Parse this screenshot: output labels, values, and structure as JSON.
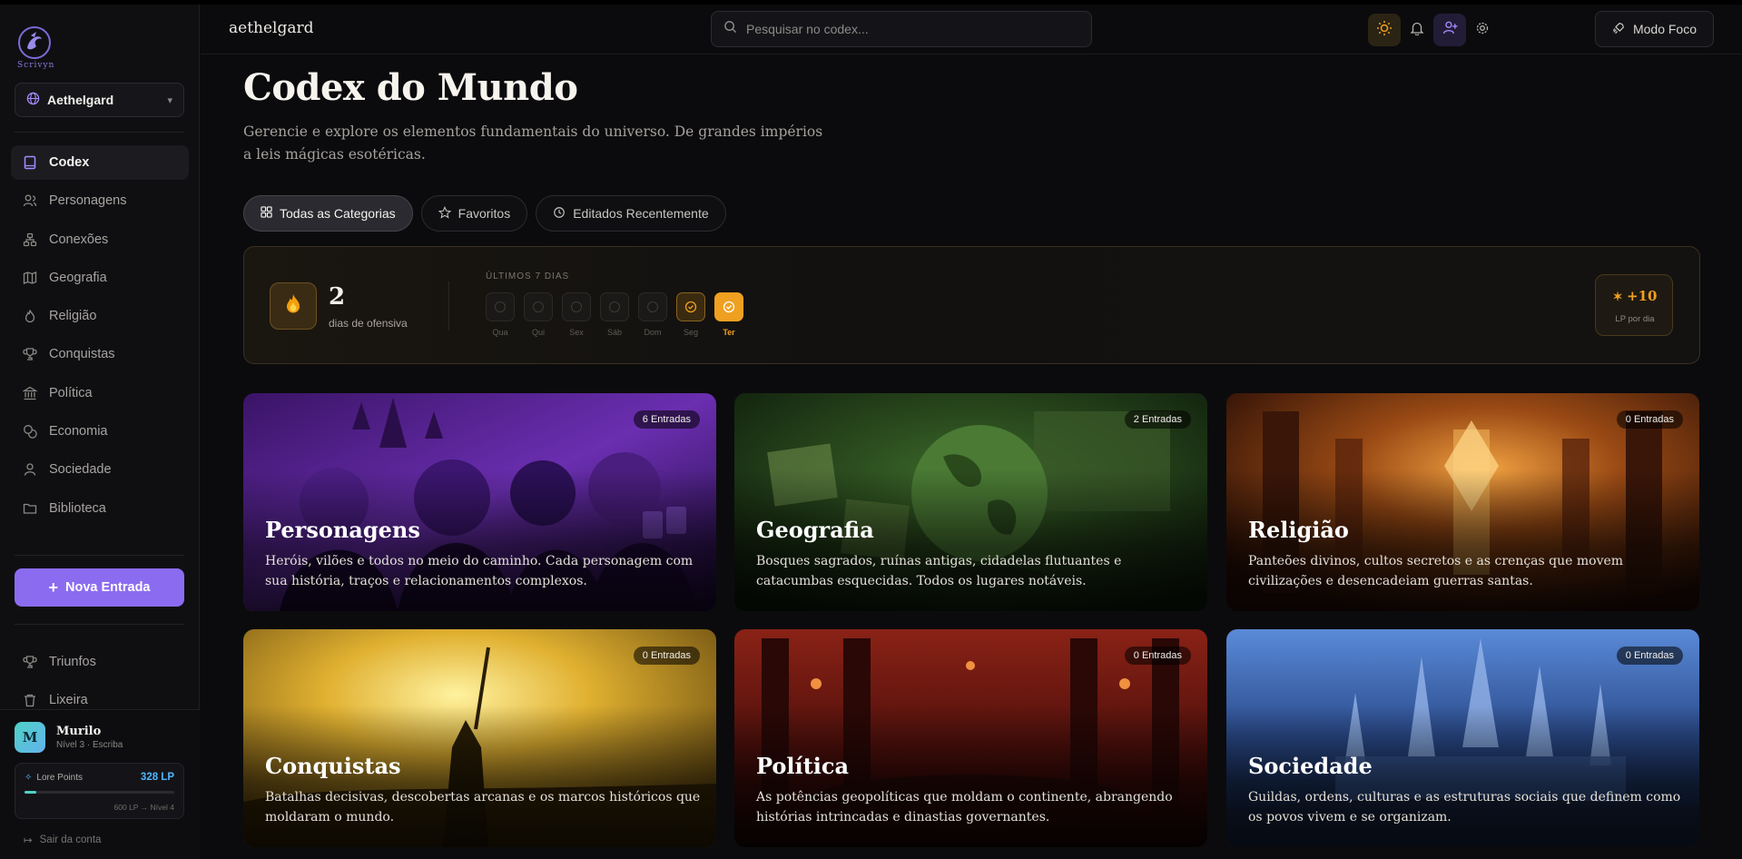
{
  "app": {
    "logo_text": "Scrivyn",
    "world": "Aethelgard",
    "world_lower": "aethelgard"
  },
  "nav": {
    "items": [
      {
        "label": "Codex",
        "icon": "book-icon",
        "active": true
      },
      {
        "label": "Personagens",
        "icon": "users-icon"
      },
      {
        "label": "Conexões",
        "icon": "network-icon"
      },
      {
        "label": "Geografia",
        "icon": "map-icon"
      },
      {
        "label": "Religião",
        "icon": "flame-icon"
      },
      {
        "label": "Conquistas",
        "icon": "trophy-icon"
      },
      {
        "label": "Política",
        "icon": "landmark-icon"
      },
      {
        "label": "Economia",
        "icon": "coins-icon"
      },
      {
        "label": "Sociedade",
        "icon": "user-icon"
      },
      {
        "label": "Biblioteca",
        "icon": "folder-icon"
      }
    ],
    "new_entry": "Nova Entrada",
    "secondary": [
      {
        "label": "Triunfos",
        "icon": "trophy-icon"
      },
      {
        "label": "Lixeira",
        "icon": "trash-icon"
      }
    ]
  },
  "user": {
    "initial": "M",
    "name": "Murilo",
    "level": "Nível 3 · Escriba",
    "lp_label": "Lore Points",
    "lp_value": "328 LP",
    "lp_progress": 0.08,
    "lp_next": "600 LP → Nível 4",
    "logout": "Sair da conta"
  },
  "header": {
    "search_placeholder": "Pesquisar no codex...",
    "focus_label": "Modo Foco"
  },
  "page": {
    "title": "Codex do Mundo",
    "description": "Gerencie e explore os elementos fundamentais do universo. De grandes impérios a leis mágicas esotéricas."
  },
  "filters": [
    {
      "label": "Todas as Categorias",
      "icon": "grid-icon",
      "active": true
    },
    {
      "label": "Favoritos",
      "icon": "star-icon"
    },
    {
      "label": "Editados Recentemente",
      "icon": "clock-icon"
    }
  ],
  "streak": {
    "count": "2",
    "label": "dias de ofensiva",
    "days_title": "ÚLTIMOS 7 DIAS",
    "days": [
      {
        "label": "Qua",
        "state": "empty"
      },
      {
        "label": "Qui",
        "state": "empty"
      },
      {
        "label": "Sex",
        "state": "empty"
      },
      {
        "label": "Sáb",
        "state": "empty"
      },
      {
        "label": "Dom",
        "state": "empty"
      },
      {
        "label": "Seg",
        "state": "done"
      },
      {
        "label": "Ter",
        "state": "today"
      }
    ],
    "lp_per_day": "+10",
    "lp_per_day_label": "LP por dia"
  },
  "cards": [
    {
      "title": "Personagens",
      "badge": "6 Entradas",
      "description": "Heróis, vilões e todos no meio do caminho. Cada personagem com sua história, traços e relacionamentos complexos.",
      "theme": "#5a2a9a"
    },
    {
      "title": "Geografia",
      "badge": "2 Entradas",
      "description": "Bosques sagrados, ruínas antigas, cidadelas flutuantes e catacumbas esquecidas. Todos os lugares notáveis.",
      "theme": "#2f5a22"
    },
    {
      "title": "Religião",
      "badge": "0 Entradas",
      "description": "Panteões divinos, cultos secretos e as crenças que movem civilizações e desencadeiam guerras santas.",
      "theme": "#9a4a14"
    },
    {
      "title": "Conquistas",
      "badge": "0 Entradas",
      "description": "Batalhas decisivas, descobertas arcanas e os marcos históricos que moldaram o mundo.",
      "theme": "#c89a1a"
    },
    {
      "title": "Política",
      "badge": "0 Entradas",
      "description": "As potências geopolíticas que moldam o continente, abrangendo histórias intrincadas e dinastias governantes.",
      "theme": "#7a1a12"
    },
    {
      "title": "Sociedade",
      "badge": "0 Entradas",
      "description": "Guildas, ordens, culturas e as estruturas sociais que definem como os povos vivem e se organizam.",
      "theme": "#2a4a8a"
    }
  ]
}
